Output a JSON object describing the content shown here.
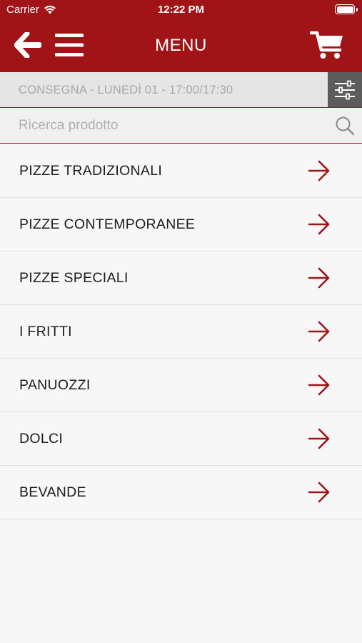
{
  "status_bar": {
    "carrier": "Carrier",
    "time": "12:22 PM"
  },
  "header": {
    "title": "MENU",
    "back_icon": "back-arrow-icon",
    "menu_icon": "hamburger-menu-icon",
    "cart_icon": "cart-icon"
  },
  "delivery": {
    "text": "CONSEGNA - LUNEDÌ 01 - 17:00/17:30",
    "filter_icon": "filter-sliders-icon"
  },
  "search": {
    "placeholder": "Ricerca prodotto",
    "value": ""
  },
  "categories": [
    {
      "label": "PIZZE TRADIZIONALI"
    },
    {
      "label": "PIZZE CONTEMPORANEE"
    },
    {
      "label": "PIZZE SPECIALI"
    },
    {
      "label": "I FRITTI"
    },
    {
      "label": "PANUOZZI"
    },
    {
      "label": "DOLCI"
    },
    {
      "label": "BEVANDE"
    }
  ],
  "colors": {
    "brand": "#a01317",
    "filter_bg": "#5c5c5c",
    "background": "#f7f7f7"
  }
}
